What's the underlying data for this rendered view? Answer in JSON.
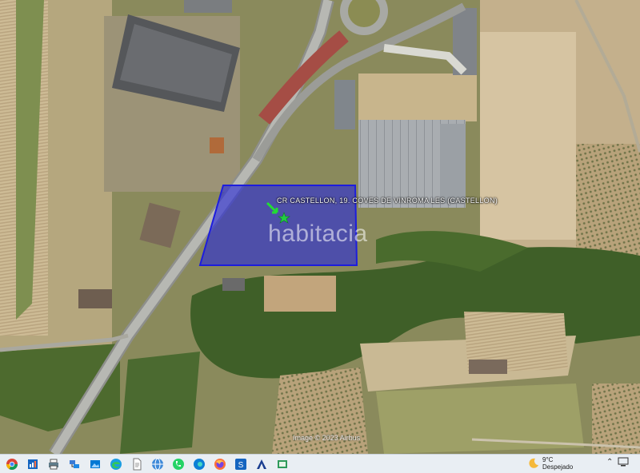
{
  "map": {
    "placemark_label": "CR CASTELLON, 19. COVES DE VINROMA LES (CASTELLON)",
    "watermark": "habitacia",
    "copyright": "Image © 2023 Airbus",
    "plot_color": "#2a2bd8",
    "placemark_icon": "star-icon",
    "pointer_icon": "green-arrow-icon"
  },
  "taskbar": {
    "icons": [
      "chrome-icon",
      "sales-app-icon",
      "printer-icon",
      "network-icon",
      "photos-icon",
      "edge-icon",
      "document-icon",
      "browser-icon",
      "whatsapp-icon",
      "edge-blue-icon",
      "firefox-icon",
      "app-s-icon",
      "app-a-icon",
      "app-green-icon"
    ],
    "weather": {
      "temperature": "9°C",
      "description": "Despejado",
      "icon": "moon-icon"
    },
    "tray_icons": [
      "chevron-up-icon",
      "network-tray-icon"
    ]
  }
}
